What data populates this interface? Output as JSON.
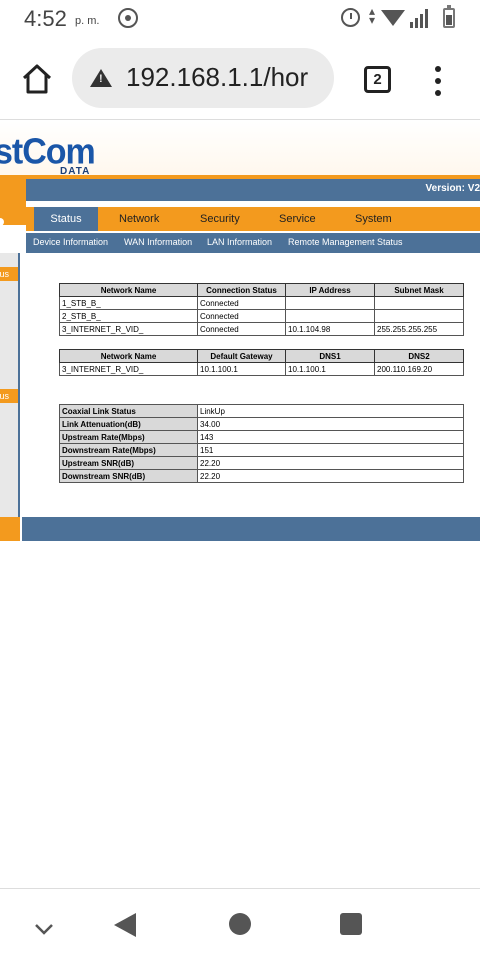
{
  "status_bar": {
    "time": "4:52",
    "ampm": "p. m."
  },
  "browser": {
    "url": "192.168.1.1/hor",
    "tab_count": "2"
  },
  "router_page": {
    "logo": "stCom",
    "logo_sub": "DATA",
    "version": "Version: V2",
    "nav_tabs": [
      "Status",
      "Network",
      "Security",
      "Service",
      "System"
    ],
    "sub_tabs": [
      "Device Information",
      "WAN Information",
      "LAN Information",
      "Remote Management Status"
    ],
    "side_labels": [
      "tus",
      "tus"
    ],
    "wan_table": {
      "headers": [
        "Network Name",
        "Connection Status",
        "IP Address",
        "Subnet Mask"
      ],
      "rows": [
        [
          "1_STB_B_",
          "Connected",
          "",
          ""
        ],
        [
          "2_STB_B_",
          "Connected",
          "",
          ""
        ],
        [
          "3_INTERNET_R_VID_",
          "Connected",
          "10.1.104.98",
          "255.255.255.255"
        ]
      ]
    },
    "gateway_table": {
      "headers": [
        "Network Name",
        "Default Gateway",
        "DNS1",
        "DNS2"
      ],
      "rows": [
        [
          "3_INTERNET_R_VID_",
          "10.1.100.1",
          "10.1.100.1",
          "200.110.169.20"
        ]
      ]
    },
    "coax_table": {
      "rows": [
        [
          "Coaxial Link Status",
          "LinkUp"
        ],
        [
          "Link Attenuation(dB)",
          "34.00"
        ],
        [
          "Upstream Rate(Mbps)",
          "143"
        ],
        [
          "Downstream Rate(Mbps)",
          "151"
        ],
        [
          "Upstream SNR(dB)",
          "22.20"
        ],
        [
          "Downstream SNR(dB)",
          "22.20"
        ]
      ]
    }
  }
}
